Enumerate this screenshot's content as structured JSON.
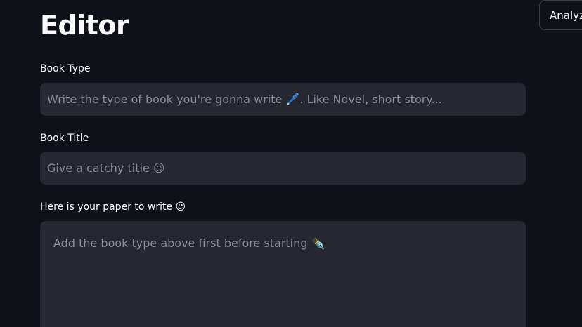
{
  "header": {
    "title": "Editor",
    "analyze_button_label": "Analyze"
  },
  "fields": {
    "book_type": {
      "label": "Book Type",
      "placeholder": "Write the type of book you're gonna write 🖊️. Like Novel, short story...",
      "value": ""
    },
    "book_title": {
      "label": "Book Title",
      "placeholder": "Give a catchy title 😉",
      "value": ""
    },
    "paper": {
      "label": "Here is your paper to write ☺",
      "placeholder": "Add the book type above first before starting ✒️",
      "value": ""
    }
  },
  "colors": {
    "background": "#0e1117",
    "input_background": "#262730",
    "text": "#fafafa",
    "placeholder": "#8b8c94"
  }
}
